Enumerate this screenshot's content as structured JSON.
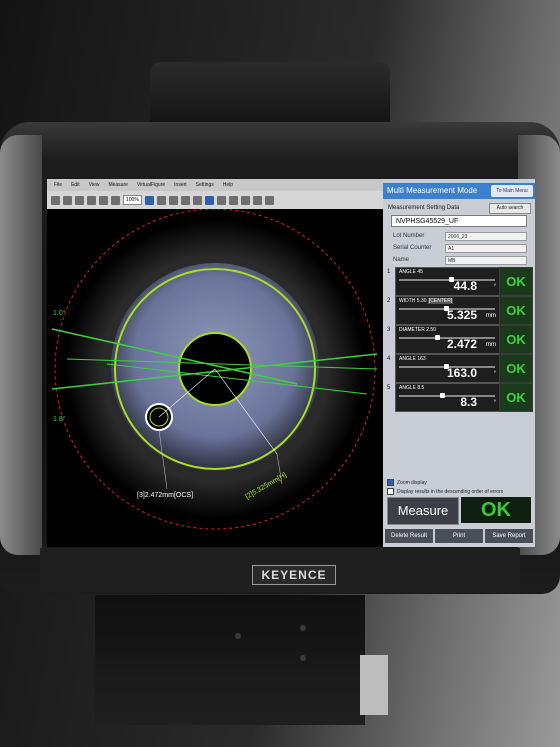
{
  "brand": "KEYENCE",
  "software": {
    "menu": [
      "File",
      "Edit",
      "View",
      "Measure",
      "VirtualFigure",
      "Insert",
      "Settings",
      "Help"
    ],
    "zoom": "100%"
  },
  "panel": {
    "title": "Multi Measurement Mode",
    "to_main_label": "To Main Menu",
    "setting_data_label": "Measurement Setting Data",
    "setting_button": "Auto search",
    "setting_value": "NVPHSG45529_UF",
    "fields": [
      {
        "label": "Lot Number",
        "value": "2006_23"
      },
      {
        "label": "Serial Counter",
        "value": "A1"
      },
      {
        "label": "Name",
        "value": "MB"
      }
    ],
    "results": [
      {
        "num": "1",
        "label": "ANGLE 45",
        "tag": "",
        "value": "44.8",
        "unit": "°",
        "status": "OK",
        "marker": 0.55
      },
      {
        "num": "2",
        "label": "WIDTH 5.30",
        "tag": "CENTER",
        "value": "5.325",
        "unit": "mm",
        "status": "OK",
        "marker": 0.5
      },
      {
        "num": "3",
        "label": "DIAMETER 2.50",
        "tag": "",
        "value": "2.472",
        "unit": "mm",
        "status": "OK",
        "marker": 0.4
      },
      {
        "num": "4",
        "label": "ANGLE 163",
        "tag": "",
        "value": "163.0",
        "unit": "°",
        "status": "OK",
        "marker": 0.5
      },
      {
        "num": "5",
        "label": "ANGLE 8.5",
        "tag": "",
        "value": "8.3",
        "unit": "°",
        "status": "OK",
        "marker": 0.45
      }
    ],
    "checkboxes": [
      {
        "label": "Zoom display",
        "checked": true
      },
      {
        "label": "Display results in the descending order of errors",
        "checked": false
      }
    ],
    "measure_label": "Measure",
    "overall_status": "OK",
    "buttons": [
      "Delete Result",
      "Print",
      "Save Report"
    ]
  },
  "overlay": {
    "angle_left_top": "1.0°",
    "angle_left_bottom": "1.8°",
    "dim_3": "[3]2.472mm[OCS]",
    "dim_2": "[2]5.325mm[H]"
  }
}
